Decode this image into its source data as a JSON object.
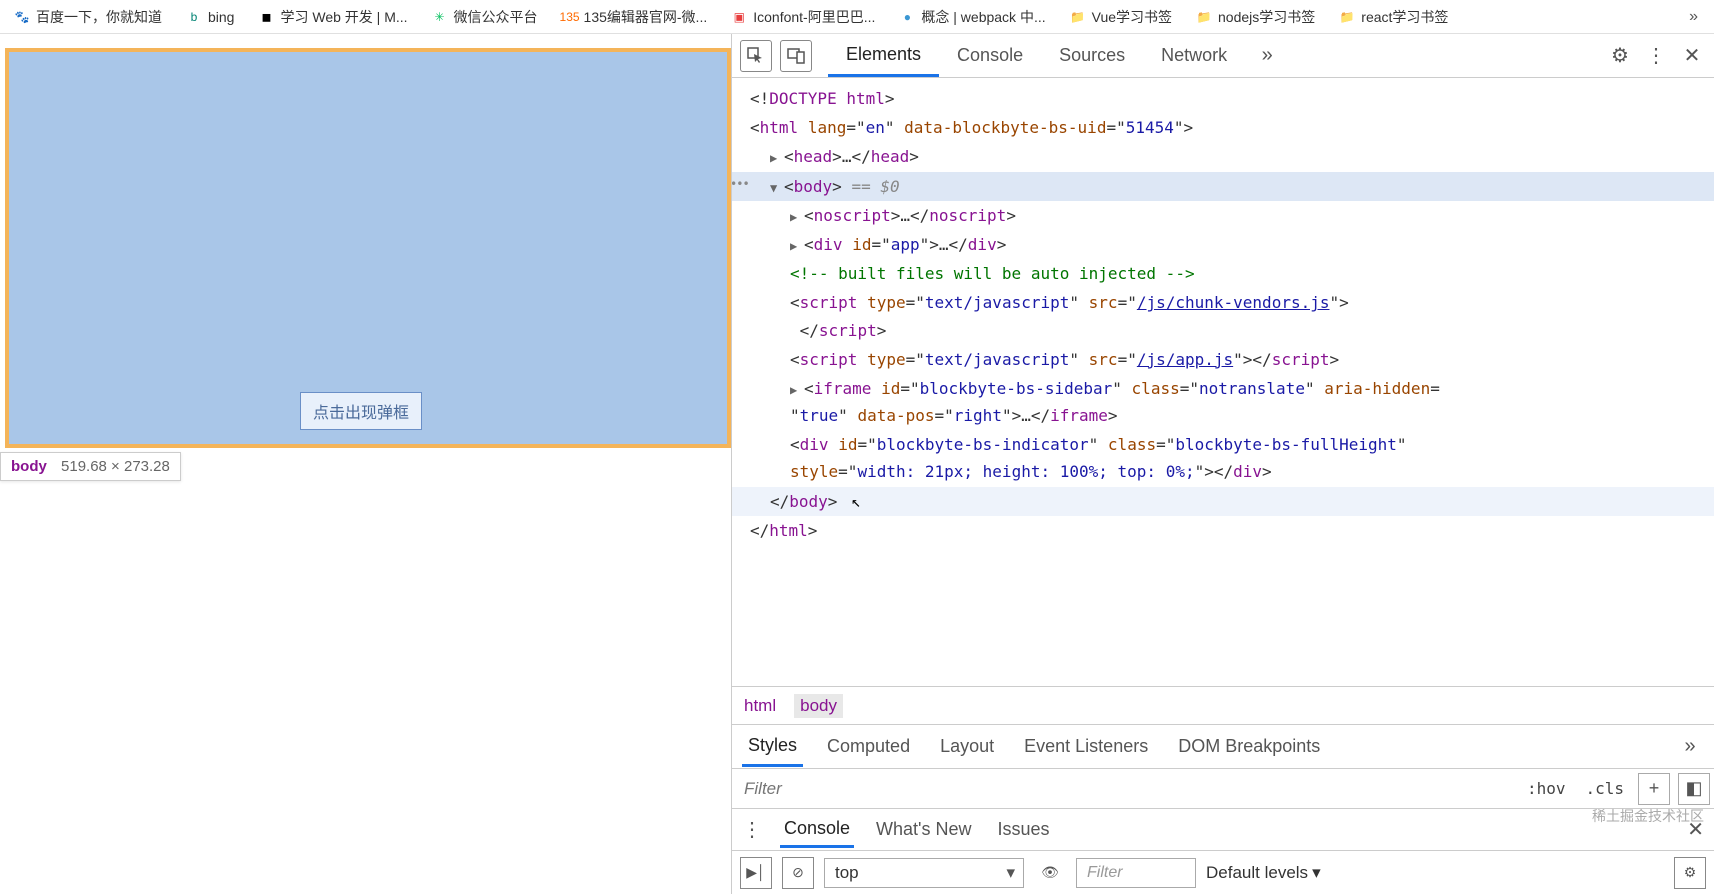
{
  "bookmarks": [
    {
      "icon": "🐾",
      "color": "#3385ff",
      "label": "百度一下，你就知道"
    },
    {
      "icon": "b",
      "color": "#008373",
      "label": "bing"
    },
    {
      "icon": "◼",
      "color": "#000",
      "label": "学习 Web 开发 | M..."
    },
    {
      "icon": "✳",
      "color": "#07c160",
      "label": "微信公众平台"
    },
    {
      "icon": "135",
      "color": "#ff6a00",
      "label": "135编辑器官网-微..."
    },
    {
      "icon": "▣",
      "color": "#e83e3e",
      "label": "Iconfont-阿里巴巴..."
    },
    {
      "icon": "●",
      "color": "#3b97d3",
      "label": "概念 | webpack 中..."
    },
    {
      "icon": "📁",
      "color": "#f6c343",
      "label": "Vue学习书签"
    },
    {
      "icon": "📁",
      "color": "#f6c343",
      "label": "nodejs学习书签"
    },
    {
      "icon": "📁",
      "color": "#f6c343",
      "label": "react学习书签"
    }
  ],
  "overflow_glyph": "»",
  "page": {
    "button_label": "点击出现弹框",
    "tip_tag": "body",
    "tip_dims": "519.68 × 273.28"
  },
  "devtools": {
    "tabs": [
      "Elements",
      "Console",
      "Sources",
      "Network"
    ],
    "active_tab": "Elements",
    "more_glyph": "»",
    "dom": {
      "doctype": "<!DOCTYPE html>",
      "html_open": {
        "lang": "en",
        "uid_attr": "data-blockbyte-bs-uid",
        "uid_val": "51454"
      },
      "head_ellipsis": "…",
      "body_eq": " == $0",
      "noscript_ellipsis": "…",
      "div_app_id": "app",
      "div_app_ellipsis": "…",
      "comment": "<!-- built files will be auto injected -->",
      "script1_type": "text/javascript",
      "script1_src": "/js/chunk-vendors.js",
      "script2_type": "text/javascript",
      "script2_src": "/js/app.js",
      "iframe_id": "blockbyte-bs-sidebar",
      "iframe_class": "notranslate",
      "iframe_hidden_attr": "aria-hidden",
      "iframe_hidden_val": "true",
      "iframe_pos_attr": "data-pos",
      "iframe_pos_val": "right",
      "iframe_ellipsis": "…",
      "indicator_id": "blockbyte-bs-indicator",
      "indicator_class": "blockbyte-bs-fullHeight",
      "indicator_style": "width: 21px; height: 100%; top: 0%;"
    },
    "breadcrumb": [
      "html",
      "body"
    ],
    "breadcrumb_active": "body",
    "styles_tabs": [
      "Styles",
      "Computed",
      "Layout",
      "Event Listeners",
      "DOM Breakpoints"
    ],
    "styles_active": "Styles",
    "filter_placeholder": "Filter",
    "hov_label": ":hov",
    "cls_label": ".cls",
    "drawer_tabs": [
      "Console",
      "What's New",
      "Issues"
    ],
    "drawer_active": "Console",
    "console": {
      "context": "top",
      "filter_placeholder": "Filter",
      "levels": "Default levels"
    }
  },
  "watermark": "稀土掘金技术社区"
}
